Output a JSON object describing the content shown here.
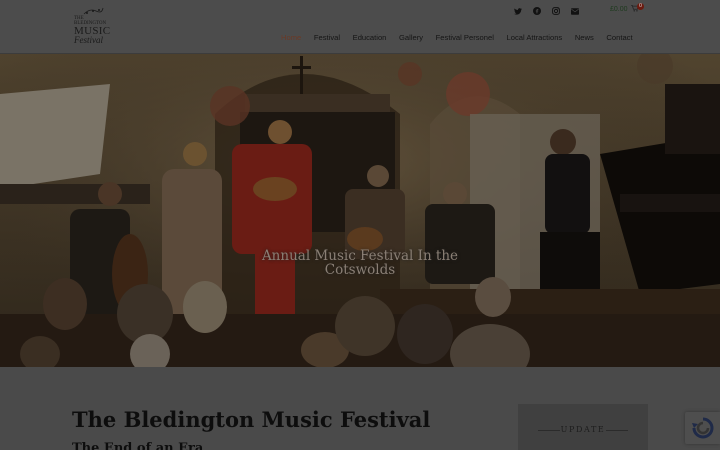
{
  "header": {
    "logo": {
      "line1": "THE",
      "line2": "BLEDINGTON",
      "line3": "MUSIC",
      "line4": "Festival"
    },
    "social": [
      {
        "icon": "twitter-icon"
      },
      {
        "icon": "facebook-icon"
      },
      {
        "icon": "instagram-icon"
      },
      {
        "icon": "email-icon"
      }
    ],
    "cart": {
      "price": "£0.00",
      "count": "0"
    },
    "nav": [
      {
        "label": "Home",
        "active": true
      },
      {
        "label": "Festival"
      },
      {
        "label": "Education"
      },
      {
        "label": "Gallery"
      },
      {
        "label": "Festival Personel"
      },
      {
        "label": "Local Attractions"
      },
      {
        "label": "News"
      },
      {
        "label": "Contact"
      }
    ]
  },
  "hero": {
    "title": "Annual Music Festival In the Cotswolds"
  },
  "main": {
    "title": "The Bledington Music Festival",
    "subtitle": "The End of an Era"
  },
  "sidebar": {
    "update_label": "UPDATE"
  },
  "colors": {
    "header_bg": "#4c4c4c",
    "active_nav": "#6b3a26",
    "badge": "#6b1a0f"
  }
}
